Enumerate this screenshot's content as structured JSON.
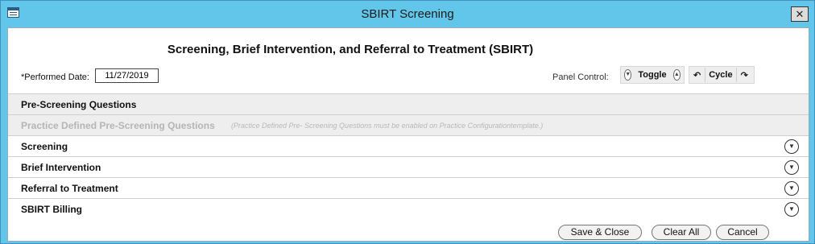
{
  "window": {
    "title": "SBIRT Screening",
    "close_glyph": "✕"
  },
  "form": {
    "heading": "Screening, Brief Intervention, and Referral to Treatment (SBIRT)",
    "performed_date_label": "*Performed Date:",
    "performed_date_value": "11/27/2019"
  },
  "panel_control": {
    "label": "Panel Control:",
    "toggle_label": "Toggle",
    "cycle_label": "Cycle"
  },
  "sections": [
    {
      "label": "Pre-Screening Questions"
    },
    {
      "label": "Practice Defined Pre-Screening Questions",
      "note": "(Practice Defined Pre- Screening Questions must be enabled on Practice Configurationtemplate.)"
    },
    {
      "label": "Screening"
    },
    {
      "label": "Brief Intervention"
    },
    {
      "label": "Referral to Treatment"
    },
    {
      "label": "SBIRT Billing"
    }
  ],
  "buttons": {
    "save_close": "Save & Close",
    "clear_all": "Clear All",
    "cancel": "Cancel"
  },
  "icons": {
    "expand": "chevron-down-circle-icon",
    "collapse": "chevron-up-circle-icon",
    "undo": "undo-arrow-icon",
    "redo": "redo-arrow-icon",
    "app": "table-icon"
  },
  "colors": {
    "titlebar": "#62c6ea",
    "section_grey": "#eeeeee"
  }
}
